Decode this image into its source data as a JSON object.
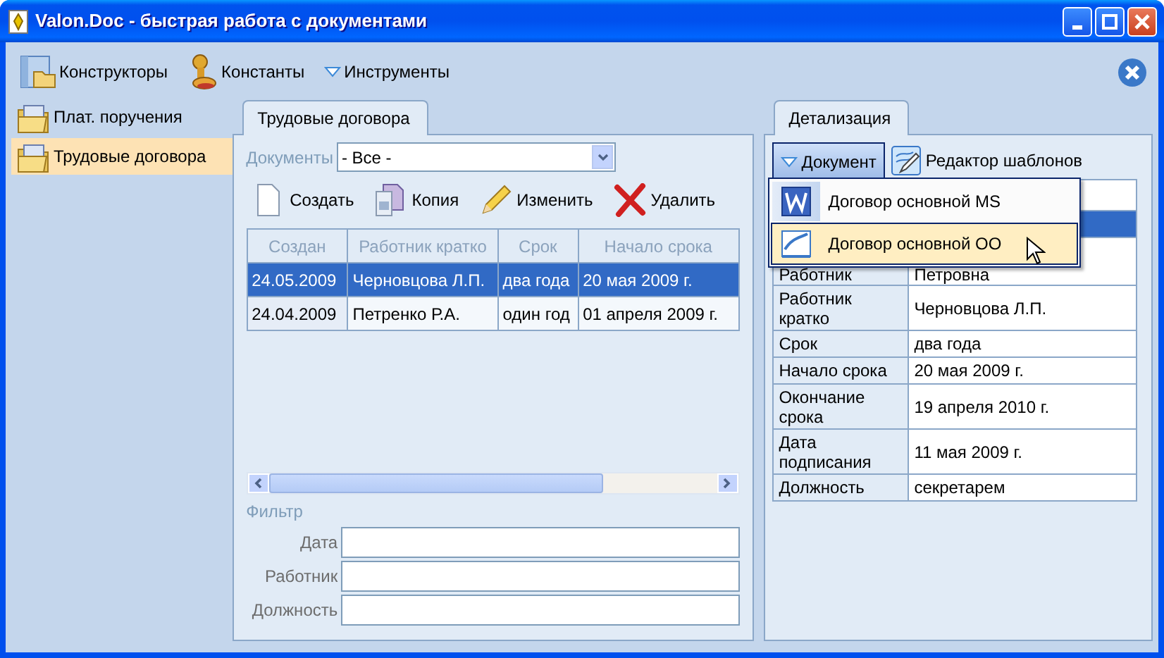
{
  "window": {
    "title": "Valon.Doc - быстрая работа с документами"
  },
  "toolbar": [
    {
      "label": "Конструкторы",
      "kind": "designer"
    },
    {
      "label": "Константы",
      "kind": "stamp"
    },
    {
      "label": "Инструменты",
      "kind": "dropdown"
    }
  ],
  "sidebar": {
    "items": [
      {
        "label": "Плат. поручения",
        "selected": false
      },
      {
        "label": "Трудовые договора",
        "selected": true
      }
    ]
  },
  "documents_panel": {
    "tab": {
      "label": "Трудовые договора"
    },
    "documents_filter": {
      "label": "Документы",
      "value": "- Все -"
    },
    "actions": [
      {
        "label": "Создать",
        "kind": "new"
      },
      {
        "label": "Копия",
        "kind": "copy"
      },
      {
        "label": "Изменить",
        "kind": "edit"
      },
      {
        "label": "Удалить",
        "kind": "delete"
      }
    ],
    "table": {
      "columns": [
        "Создан",
        "Работник кратко",
        "Срок",
        "Начало срока"
      ],
      "rows": [
        {
          "cells": [
            "24.05.2009",
            "Черновцова Л.П.",
            "два года",
            "20 мая 2009 г."
          ],
          "selected": true
        },
        {
          "cells": [
            "24.04.2009",
            "Петренко Р.А.",
            "один год",
            "01 апреля 2009 г."
          ],
          "selected": false
        }
      ]
    },
    "filter": {
      "title": "Фильтр",
      "fields": [
        {
          "label": "Дата"
        },
        {
          "label": "Работник"
        },
        {
          "label": "Должность"
        }
      ]
    }
  },
  "details_panel": {
    "tab": {
      "label": "Детализация"
    },
    "toolbar": [
      {
        "label": "Документ",
        "kind": "dropdown",
        "expanded": true
      },
      {
        "label": "Редактор шаблонов",
        "kind": "editor"
      }
    ],
    "menu": [
      {
        "label": "Договор основной MS",
        "kind": "word",
        "selected": false
      },
      {
        "label": "Договор основной OO",
        "kind": "writer",
        "selected": true
      }
    ],
    "rows": [
      {
        "selected": false
      },
      {
        "selected": true
      },
      {
        "label": "Работник",
        "value": "Петровна",
        "selected": false
      },
      {
        "label": "Работник кратко",
        "value": "Черновцова Л.П.",
        "selected": false
      },
      {
        "label": "Срок",
        "value": "два года",
        "selected": false
      },
      {
        "label": "Начало срока",
        "value": "20 мая 2009 г.",
        "selected": false
      },
      {
        "label": "Окончание срока",
        "value": "19 апреля 2010 г.",
        "selected": false
      },
      {
        "label": "Дата подписания",
        "value": "11 мая 2009 г.",
        "selected": false
      },
      {
        "label": "Должность",
        "value": "секретарем",
        "selected": false
      }
    ]
  }
}
